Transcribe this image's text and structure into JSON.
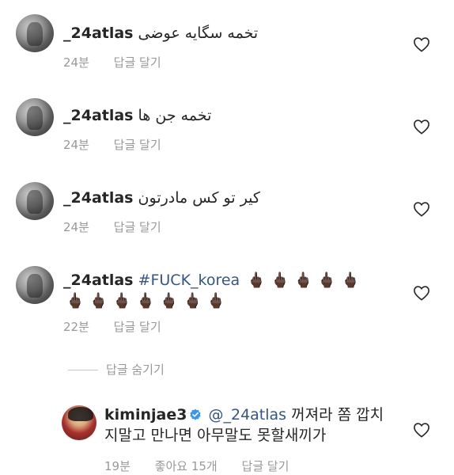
{
  "comments": [
    {
      "username": "_24atlas",
      "text": "تخمه سگایه عوضی",
      "time": "24분",
      "reply_label": "답글 달기"
    },
    {
      "username": "_24atlas",
      "text": "تخمه جن ها",
      "time": "24분",
      "reply_label": "답글 달기"
    },
    {
      "username": "_24atlas",
      "text": "کیر تو کس مادرتون",
      "time": "24분",
      "reply_label": "답글 달기"
    },
    {
      "username": "_24atlas",
      "hashtag": "#FUCK_korea",
      "emoji_row1": "🖕🏿 🖕🏿 🖕🏿 🖕🏿 🖕🏿",
      "emoji_row2": "🖕🏿 🖕🏿 🖕🏿 🖕🏿 🖕🏿 🖕🏿 🖕🏿",
      "time": "22분",
      "reply_label": "답글 달기"
    }
  ],
  "hide_replies_label": "답글 숨기기",
  "reply": {
    "username": "kiminjae3",
    "mention": "@_24atlas",
    "text_line1": "꺼져라 쫌 깝치",
    "text_line2": "지말고 만나면 아무말도 못할새끼가",
    "time": "19분",
    "likes": "좋아요 15개",
    "reply_label": "답글 달기"
  },
  "icons": {
    "like": "heart-outline-icon",
    "verified": "verified-badge-icon"
  },
  "colors": {
    "mention": "#34558b",
    "meta": "#999999",
    "verified": "#3897f0"
  }
}
